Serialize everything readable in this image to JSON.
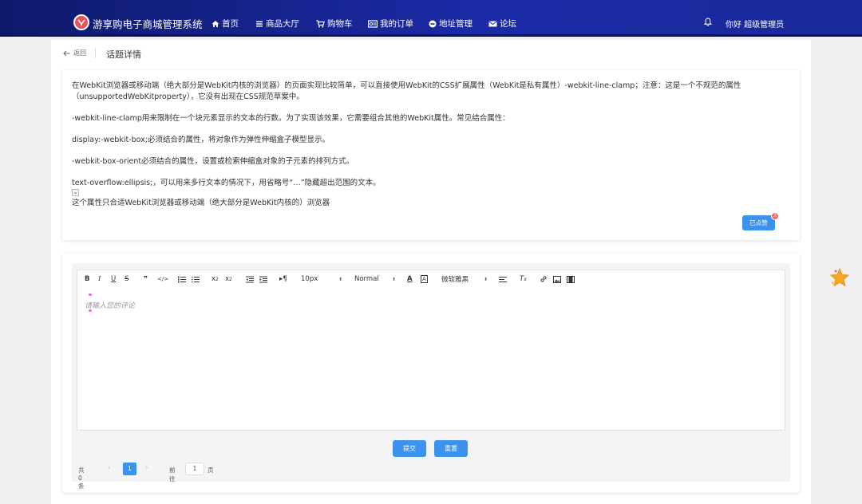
{
  "header": {
    "brand": "游享购电子商城管理系统",
    "nav": [
      {
        "label": "首页",
        "icon": "home-icon"
      },
      {
        "label": "商品大厅",
        "icon": "list-icon"
      },
      {
        "label": "购物车",
        "icon": "cart-icon"
      },
      {
        "label": "我的订单",
        "icon": "order-icon"
      },
      {
        "label": "地址管理",
        "icon": "address-icon"
      },
      {
        "label": "论坛",
        "icon": "mail-icon"
      }
    ],
    "greeting": "你好 超级管理员"
  },
  "page": {
    "back_label": "返回",
    "title": "话题详情"
  },
  "topic": {
    "paragraphs": [
      "在WebKit浏览器或移动端（绝大部分是WebKit内核的浏览器）的页面实现比较简单，可以直接使用WebKit的CSS扩展属性（WebKit是私有属性）-webkit-line-clamp；注意：这是一个不规范的属性（unsupportedWebKitproperty），它没有出现在CSS规范草案中。",
      "-webkit-line-clamp用来限制在一个块元素显示的文本的行数。为了实现该效果，它需要组合其他的WebKit属性。常见结合属性：",
      "display:-webkit-box;必须结合的属性，将对象作为弹性伸缩盒子模型显示。",
      "-webkit-box-orient必须结合的属性，设置或检索伸缩盒对象的子元素的排列方式。",
      "text-overflow:ellipsis;，可以用来多行文本的情况下，用省略号“…”隐藏超出范围的文本。"
    ],
    "last_line": "这个属性只合适WebKit浏览器或移动端（绝大部分是WebKit内核的）浏览器",
    "like_label": "已点赞",
    "like_count": "3"
  },
  "editor": {
    "font_size": "10px",
    "heading": "Normal",
    "font_family": "微软雅黑",
    "placeholder": "请输入您的评论"
  },
  "actions": {
    "submit": "提交",
    "reset": "重置"
  },
  "pagination": {
    "total": "共 0 条",
    "current": "1",
    "goto_label": "前往",
    "goto_value": "1",
    "unit": "页"
  }
}
